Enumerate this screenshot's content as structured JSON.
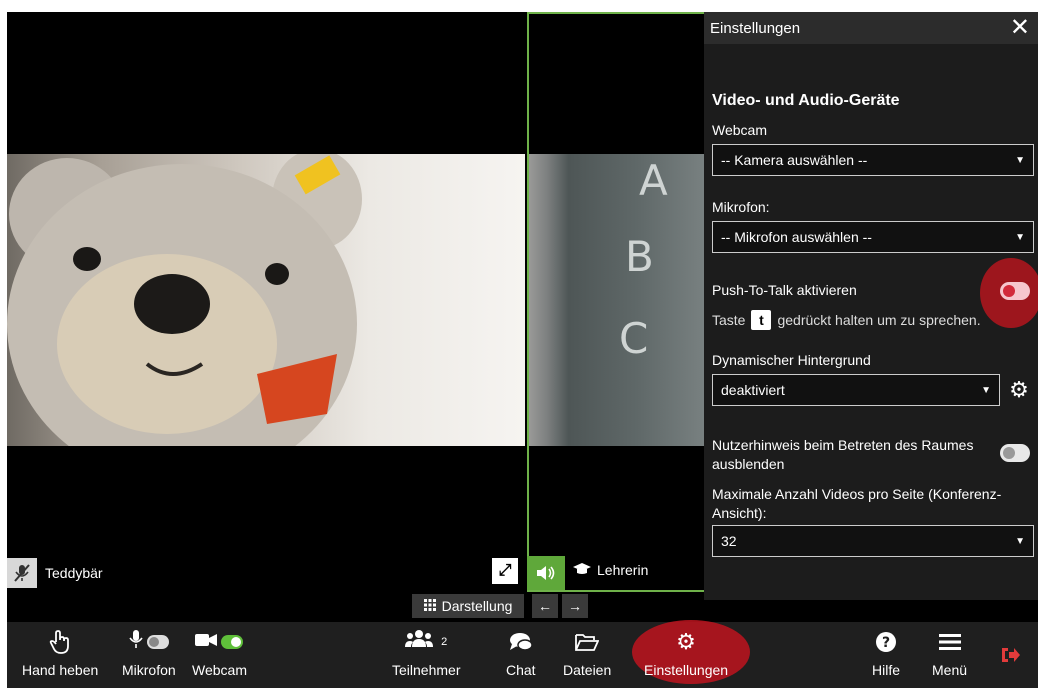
{
  "tiles": {
    "left": {
      "name": "Teddybär",
      "mic_icon": "mic-off-icon"
    },
    "right": {
      "name": "Lehrerin",
      "letters": [
        "A",
        "B",
        "C"
      ],
      "speaker_icon": "speaker-icon",
      "teacher_icon": "graduation-cap-icon"
    }
  },
  "settings": {
    "title": "Einstellungen",
    "close_label": "✕",
    "section_title": "Video- und Audio-Geräte",
    "webcam_label": "Webcam",
    "webcam_select": "-- Kamera auswählen --",
    "mic_label": "Mikrofon:",
    "mic_select": "-- Mikrofon auswählen --",
    "ptt_label": "Push-To-Talk aktivieren",
    "ptt_hint_prefix": "Taste",
    "ptt_key": "t",
    "ptt_hint_suffix": "gedrückt halten um zu sprechen.",
    "bg_label": "Dynamischer Hintergrund",
    "bg_select": "deaktiviert",
    "hint_label": "Nutzerhinweis beim Betreten des Raumes ausblenden",
    "max_label": "Maximale Anzahl Videos pro Seite (Konferenz-Ansicht):",
    "max_select": "32"
  },
  "layout_bar": {
    "label": "Darstellung",
    "prev": "←",
    "next": "→"
  },
  "toolbar": {
    "hand": "Hand heben",
    "mic": "Mikrofon",
    "webcam": "Webcam",
    "participants": "Teilnehmer",
    "participants_count": "2",
    "chat": "Chat",
    "files": "Dateien",
    "settings": "Einstellungen",
    "help": "Hilfe",
    "menu": "Menü"
  },
  "colors": {
    "accent_green": "#5fa83a",
    "highlight_red": "#c8141e",
    "panel_bg": "#1c1c1c"
  }
}
